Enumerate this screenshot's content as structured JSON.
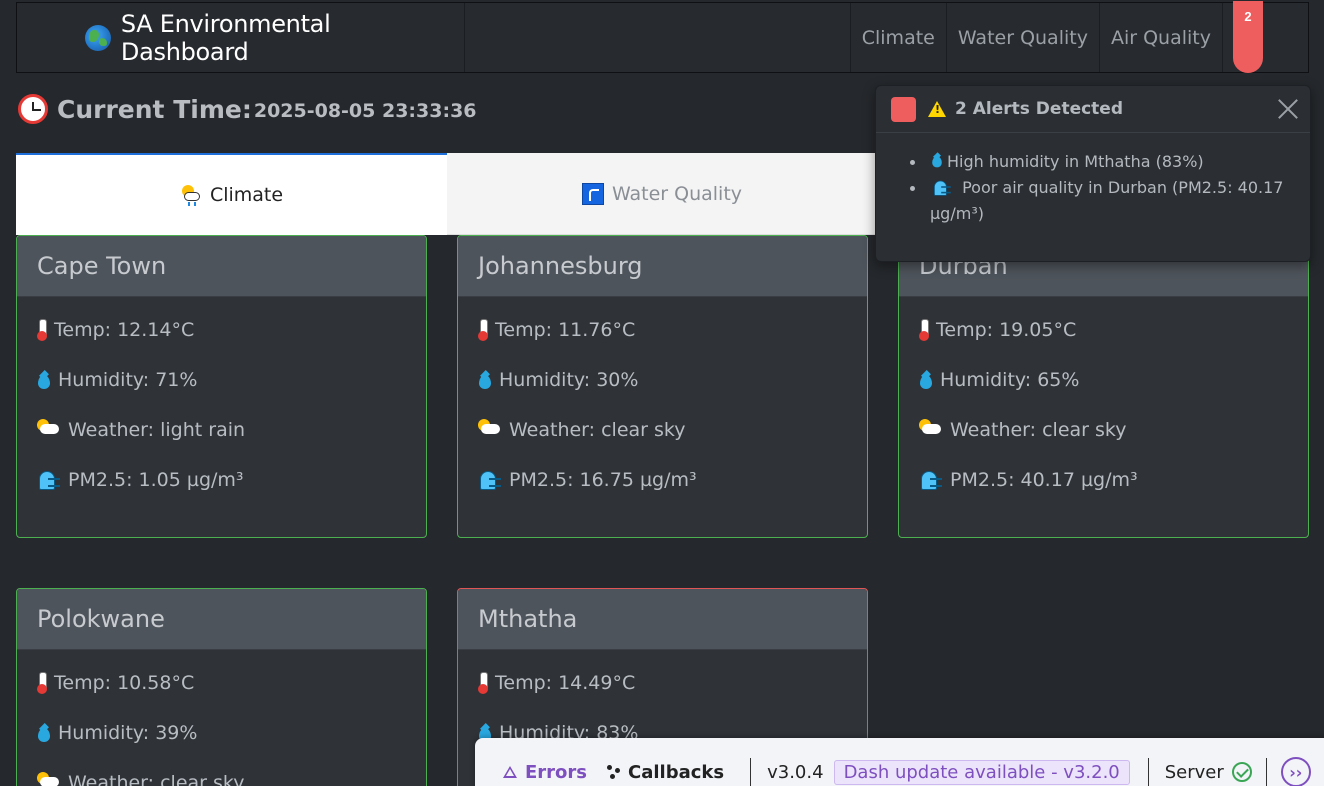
{
  "navbar": {
    "brand": "SA Environmental Dashboard",
    "brand_icon": "globe-icon",
    "links": [
      "Climate",
      "Water Quality",
      "Air Quality"
    ],
    "notification_count": "2"
  },
  "time": {
    "label": "Current Time:",
    "value": "2025-08-05 23:33:36",
    "icon": "alarm-clock-icon"
  },
  "tabs": [
    {
      "label": "Climate",
      "icon": "sun-cloud-rain-icon",
      "active": true
    },
    {
      "label": "Water Quality",
      "icon": "water-tap-icon",
      "active": false
    }
  ],
  "cards": [
    {
      "city": "Cape Town",
      "temp": "Temp: 12.14°C",
      "humidity": "Humidity: 71%",
      "weather": "Weather: light rain",
      "pm25": "PM2.5: 1.05 µg/m³",
      "status": "ok"
    },
    {
      "city": "Johannesburg",
      "temp": "Temp: 11.76°C",
      "humidity": "Humidity: 30%",
      "weather": "Weather: clear sky",
      "pm25": "PM2.5: 16.75 µg/m³",
      "status": "ok"
    },
    {
      "city": "Durban",
      "temp": "Temp: 19.05°C",
      "humidity": "Humidity: 65%",
      "weather": "Weather: clear sky",
      "pm25": "PM2.5: 40.17 µg/m³",
      "status": "ok"
    },
    {
      "city": "Polokwane",
      "temp": "Temp: 10.58°C",
      "humidity": "Humidity: 39%",
      "weather": "Weather: clear sky",
      "pm25": "",
      "status": "ok"
    },
    {
      "city": "Mthatha",
      "temp": "Temp: 14.49°C",
      "humidity": "Humidity: 83%",
      "weather": "",
      "pm25": "",
      "status": "alert"
    }
  ],
  "alerts": {
    "title": "2 Alerts Detected",
    "items": [
      "High humidity in Mthatha (83%)",
      "Poor air quality in Durban (PM2.5: 40.17 µg/m³)"
    ]
  },
  "debug": {
    "errors": "Errors",
    "callbacks": "Callbacks",
    "version": "v3.0.4",
    "update": "Dash update available - v3.2.0",
    "server": "Server"
  },
  "colors": {
    "background": "#25282c",
    "card_ok_border": "#4caf50",
    "card_alert_border": "#e05656",
    "badge": "#ee5e5f",
    "tab_active_border": "#1e6fd9",
    "dash_accent": "#7e4fbf"
  }
}
